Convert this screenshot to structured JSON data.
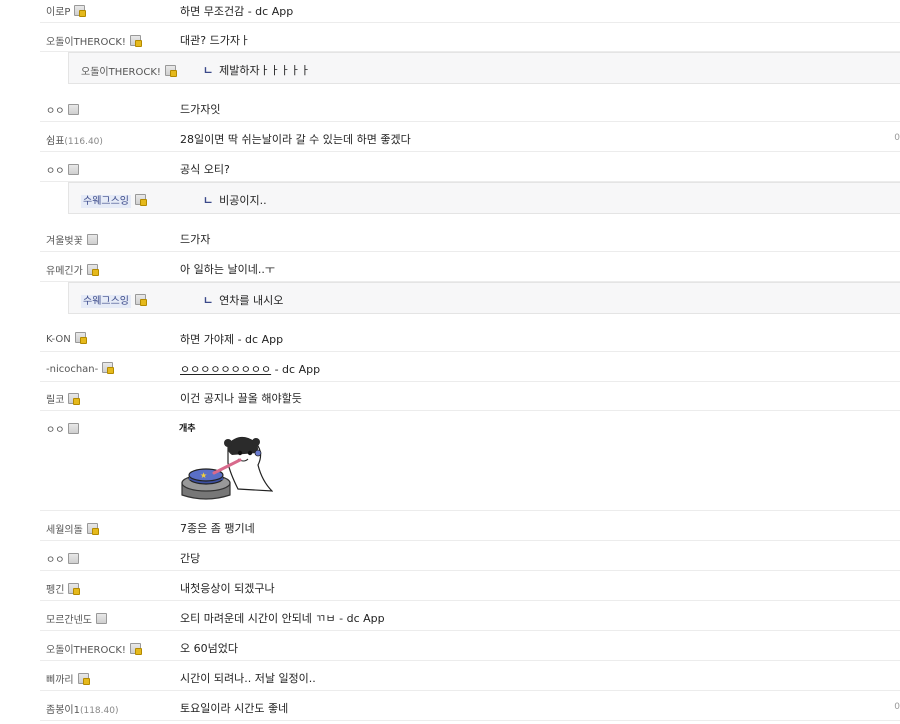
{
  "comments": [
    {
      "nick": "이로P",
      "badge": "fix",
      "msg": "하면 무조건감 - dc App"
    },
    {
      "nick": "오돌이THEROCK!",
      "badge": "fix",
      "msg": "대관? 드가자ㅏ"
    },
    {
      "nick": "오돌이THEROCK!",
      "badge": "fix",
      "msg": "제발하자ㅏㅏㅏㅏㅏ",
      "reply": true
    },
    {
      "nick": "ㅇㅇ",
      "badge": "plain",
      "msg": "드가자잇"
    },
    {
      "nick": "쉼표",
      "ip": "(116.40)",
      "msg": "28일이면 딱 쉬는날이라 갈 수 있는데 하면 좋겠다",
      "num": "0"
    },
    {
      "nick": "ㅇㅇ",
      "badge": "plain",
      "msg": "공식 오티?"
    },
    {
      "nick": "수웨그스잉",
      "badge": "fix",
      "msg": "비공이지..",
      "reply": true,
      "hl": true
    },
    {
      "nick": "겨울벚꽃",
      "badge": "plain",
      "msg": "드가자"
    },
    {
      "nick": "유메긴가",
      "badge": "fix",
      "msg": "아 일하는 날이네..ㅜ"
    },
    {
      "nick": "수웨그스잉",
      "badge": "fix",
      "msg": "연차를 내시오",
      "reply": true,
      "hl": true
    },
    {
      "nick": "K-ON",
      "badge": "fix",
      "msg": "하면 가야제 - dc App"
    },
    {
      "nick": "-nicochan-",
      "badge": "fix",
      "msg": "ㅇㅇㅇㅇㅇㅇㅇㅇㅇ - dc App",
      "ul": "ㅇㅇㅇㅇㅇㅇㅇㅇㅇ"
    },
    {
      "nick": "릴코",
      "badge": "fix",
      "msg": "이건 공지나 끌올 해야할듯"
    },
    {
      "nick": "ㅇㅇ",
      "badge": "plain",
      "msg": "",
      "sticker": "개추"
    },
    {
      "nick": "세월의돌",
      "badge": "fix",
      "msg": "7종은 좀 팽기네"
    },
    {
      "nick": "ㅇㅇ",
      "badge": "plain",
      "msg": "간당"
    },
    {
      "nick": "펭긴",
      "badge": "fix",
      "msg": "내첫응상이 되겠구나"
    },
    {
      "nick": "모르간넨도",
      "badge": "plain",
      "msg": "오티 마려운데 시간이 안되네 ㄲㅂ - dc App"
    },
    {
      "nick": "오돌이THEROCK!",
      "badge": "fix",
      "msg": "오 60넘었다"
    },
    {
      "nick": "삐까리",
      "badge": "fix",
      "msg": "시간이 되려나.. 저날 일정이.."
    },
    {
      "nick": "좀봉이1",
      "ip": "(118.40)",
      "msg": "토요일이라 시간도 좋네",
      "num": "0"
    }
  ]
}
